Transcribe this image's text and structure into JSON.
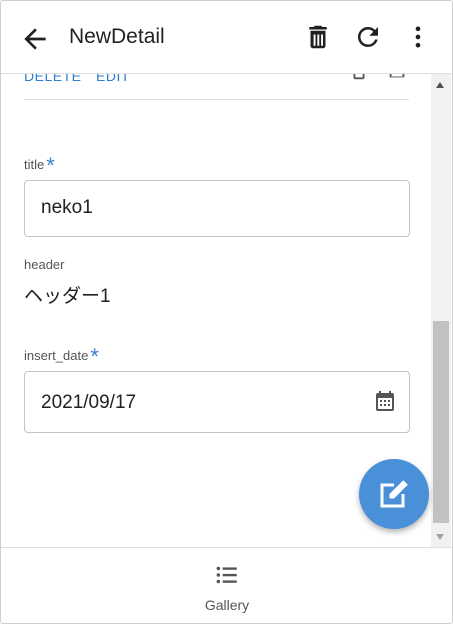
{
  "appbar": {
    "title": "NewDetail",
    "back_icon": "arrow-left-icon",
    "delete_icon": "trash-icon",
    "refresh_icon": "refresh-icon",
    "menu_icon": "more-vert-icon"
  },
  "actions": {
    "delete_label": "DELETE",
    "edit_label": "EDIT"
  },
  "form": {
    "title_label": "title",
    "title_value": "neko1",
    "header_label": "header",
    "header_value": "ヘッダー1",
    "insert_date_label": "insert_date",
    "insert_date_value": "2021/09/17",
    "required_mark": "*"
  },
  "bottom_nav": {
    "gallery_label": "Gallery"
  },
  "colors": {
    "accent": "#4a90d9",
    "link": "#2f7dd0"
  }
}
